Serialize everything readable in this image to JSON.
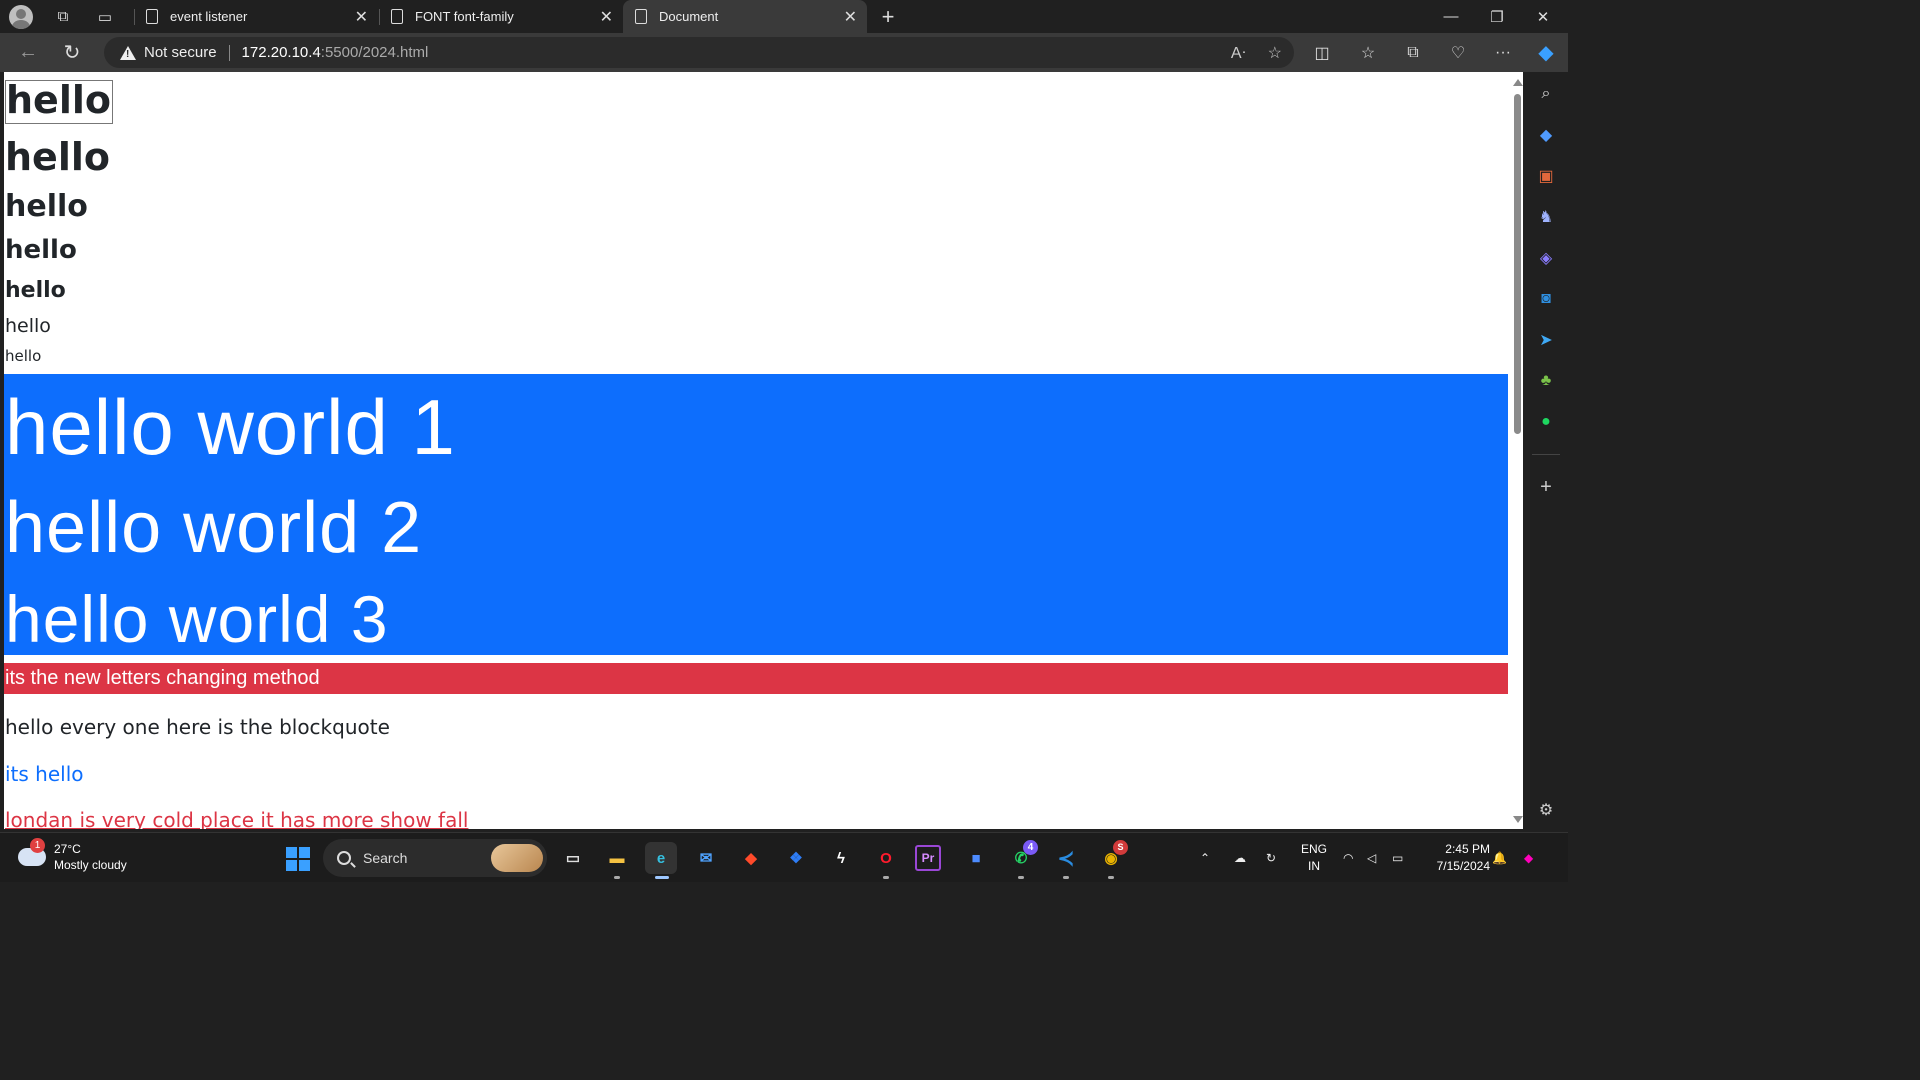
{
  "browser": {
    "tabs": [
      {
        "title": "event listener",
        "active": false
      },
      {
        "title": "FONT font-family",
        "active": false
      },
      {
        "title": "Document",
        "active": true
      }
    ],
    "address": {
      "security_label": "Not secure",
      "host": "172.20.10.4",
      "path": ":5500/2024.html"
    }
  },
  "page": {
    "headings": [
      "hello",
      "hello",
      "hello",
      "hello",
      "hello",
      "hello",
      "hello"
    ],
    "display_lines": [
      "hello world 1",
      "hello world 2",
      "hello world 3"
    ],
    "red_banner": "its the new letters changing method",
    "blockquote": "hello every one here is the blockquote",
    "link_text": "its hello",
    "underlined_text": "londan is very cold place it has more show fall"
  },
  "taskbar": {
    "weather": {
      "temp": "27°C",
      "condition": "Mostly cloudy",
      "badge": "1"
    },
    "search_label": "Search",
    "whatsapp_badge": "4",
    "chrome_badge": "S",
    "language": {
      "line1": "ENG",
      "line2": "IN"
    },
    "clock": {
      "time": "2:45 PM",
      "date": "7/15/2024"
    }
  },
  "colors": {
    "primary_blue": "#0d6efd",
    "danger_red": "#dc3545"
  }
}
